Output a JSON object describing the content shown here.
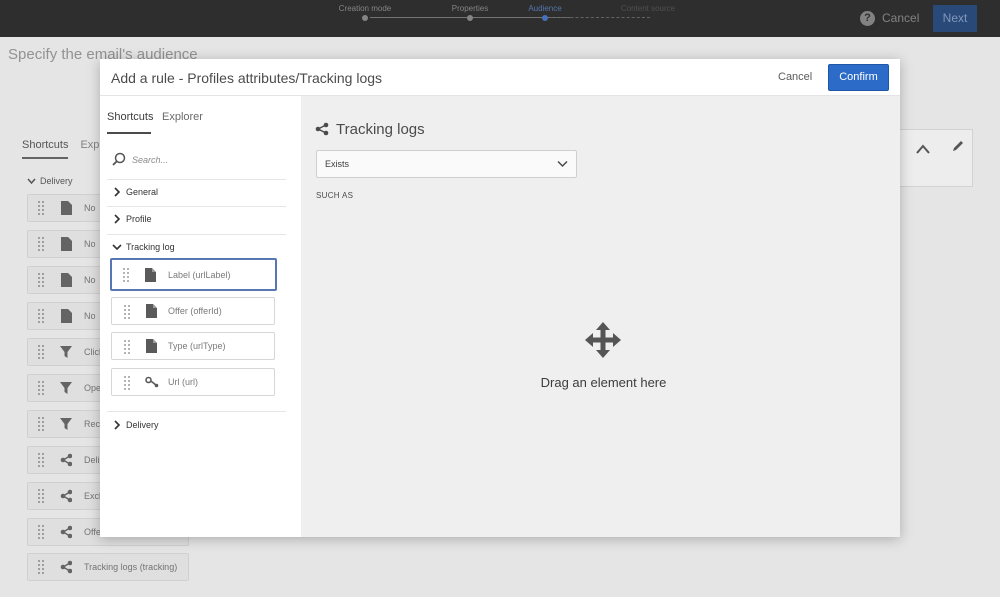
{
  "topbar": {
    "steps": [
      {
        "label": "Creation mode",
        "state": "done"
      },
      {
        "label": "Properties",
        "state": "done"
      },
      {
        "label": "Audience",
        "state": "active"
      },
      {
        "label": "Content source",
        "state": "future"
      }
    ],
    "help_icon": "question-icon",
    "help_glyph": "?",
    "cancel_label": "Cancel",
    "next_label": "Next"
  },
  "page": {
    "title": "Specify the email's audience",
    "tabs": [
      "Shortcuts",
      "Explo"
    ],
    "group_label": "Delivery",
    "items": [
      {
        "label": "No",
        "icon": "document-icon"
      },
      {
        "label": "No",
        "icon": "document-icon"
      },
      {
        "label": "No",
        "icon": "document-icon"
      },
      {
        "label": "No",
        "icon": "document-icon"
      },
      {
        "label": "Click",
        "icon": "filter-icon"
      },
      {
        "label": "Ope",
        "icon": "filter-icon"
      },
      {
        "label": "Reci",
        "icon": "filter-icon"
      },
      {
        "label": "Deli",
        "icon": "link-icon"
      },
      {
        "label": "Excl",
        "icon": "link-icon"
      },
      {
        "label": "Offe",
        "icon": "link-icon"
      },
      {
        "label": "Tracking logs (tracking)",
        "icon": "link-icon"
      }
    ]
  },
  "modal": {
    "title": "Add a rule - Profiles attributes/Tracking logs",
    "cancel_label": "Cancel",
    "confirm_label": "Confirm",
    "left": {
      "tabs": [
        "Shortcuts",
        "Explorer"
      ],
      "active_tab": "Shortcuts",
      "search_placeholder": "Search...",
      "categories": {
        "general": "General",
        "profile": "Profile",
        "tracking_log": "Tracking log",
        "delivery": "Delivery"
      },
      "fields": [
        {
          "label": "Label (urlLabel)",
          "icon": "document-icon",
          "selected": true
        },
        {
          "label": "Offer (offerId)",
          "icon": "document-icon",
          "selected": false
        },
        {
          "label": "Type (urlType)",
          "icon": "document-icon",
          "selected": false
        },
        {
          "label": "Url (url)",
          "icon": "link-key-icon",
          "selected": false
        }
      ]
    },
    "right": {
      "title": "Tracking logs",
      "icon": "share-link-icon",
      "operator": "Exists",
      "such_as": "SUCH AS",
      "drop_text": "Drag an element here",
      "drop_icon": "move-icon"
    }
  },
  "colors": {
    "topbar": "#313131",
    "accent": "#2d6bc8",
    "selected_border": "#5677b4",
    "panel_bg": "#efefef"
  }
}
